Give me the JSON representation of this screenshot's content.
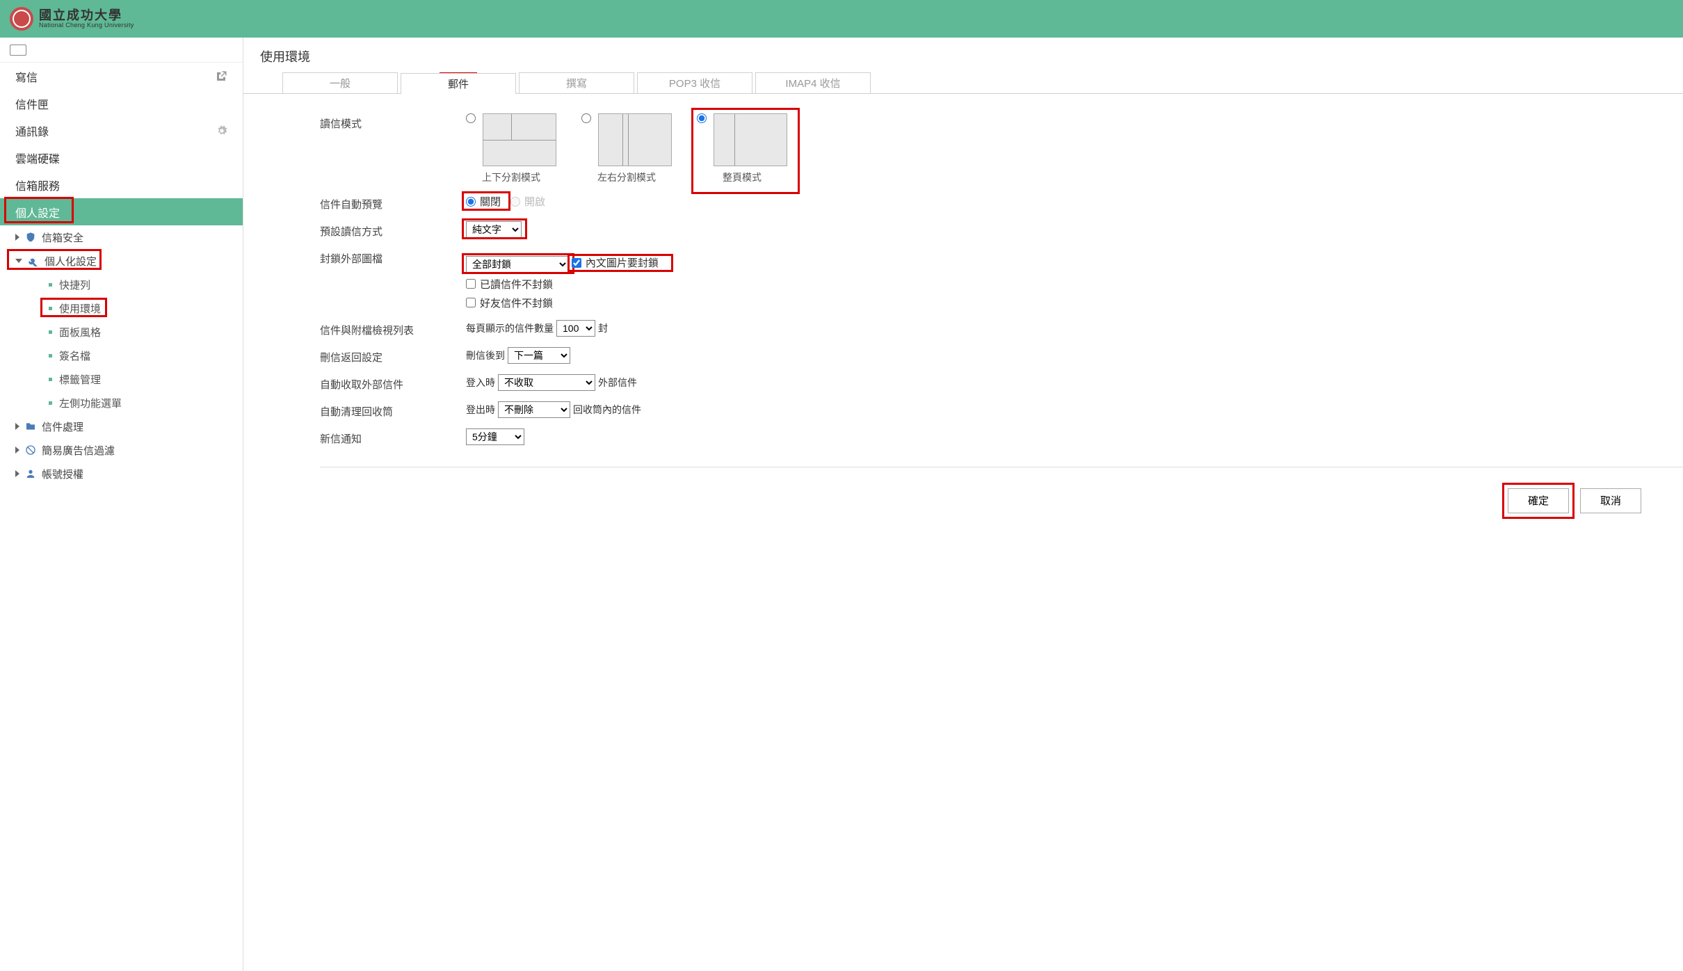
{
  "header": {
    "university_zh": "國立成功大學",
    "university_en": "National Cheng Kung University"
  },
  "sidebar": {
    "compose": "寫信",
    "inbox": "信件匣",
    "contacts": "通訊錄",
    "cloud": "雲端硬碟",
    "mailbox_service": "信箱服務",
    "personal_settings": "個人設定",
    "groups": {
      "mailbox_security": "信箱安全",
      "personalization": "個人化設定",
      "mail_processing": "信件處理",
      "spam_filter": "簡易廣告信過濾",
      "account_auth": "帳號授權"
    },
    "leaves": {
      "shortcut": "快捷列",
      "environment": "使用環境",
      "panel_style": "面板風格",
      "signature": "簽名檔",
      "tag_mgmt": "標籤管理",
      "left_menu": "左側功能選單"
    }
  },
  "main": {
    "title": "使用環境",
    "tabs": {
      "general": "一般",
      "mail": "郵件",
      "compose": "撰寫",
      "pop3": "POP3 收信",
      "imap4": "IMAP4 收信"
    },
    "labels": {
      "read_mode": "讀信模式",
      "mode_tb": "上下分割模式",
      "mode_lr": "左右分割模式",
      "mode_full": "整頁模式",
      "auto_preview": "信件自動預覽",
      "preview_off": "關閉",
      "preview_on": "開啟",
      "default_read": "預設讀信方式",
      "default_read_val": "純文字",
      "block_ext_img": "封鎖外部圖檔",
      "block_ext_val": "全部封鎖",
      "chk_inline_block": "內文圖片要封鎖",
      "chk_read_noblock": "已讀信件不封鎖",
      "chk_friend_noblock": "好友信件不封鎖",
      "list_view": "信件與附檔檢視列表",
      "list_prefix": "每頁顯示的信件數量",
      "list_count": "100",
      "list_suffix": "封",
      "delete_return": "刪信返回設定",
      "delete_prefix": "刪信後到",
      "delete_val": "下一篇",
      "auto_fetch": "自動收取外部信件",
      "fetch_prefix": "登入時",
      "fetch_val": "不收取",
      "fetch_suffix": "外部信件",
      "auto_clean": "自動清理回收筒",
      "clean_prefix": "登出時",
      "clean_val": "不刪除",
      "clean_suffix": "回收筒內的信件",
      "new_mail_notify": "新信通知",
      "notify_val": "5分鐘"
    },
    "buttons": {
      "ok": "確定",
      "cancel": "取消"
    }
  }
}
